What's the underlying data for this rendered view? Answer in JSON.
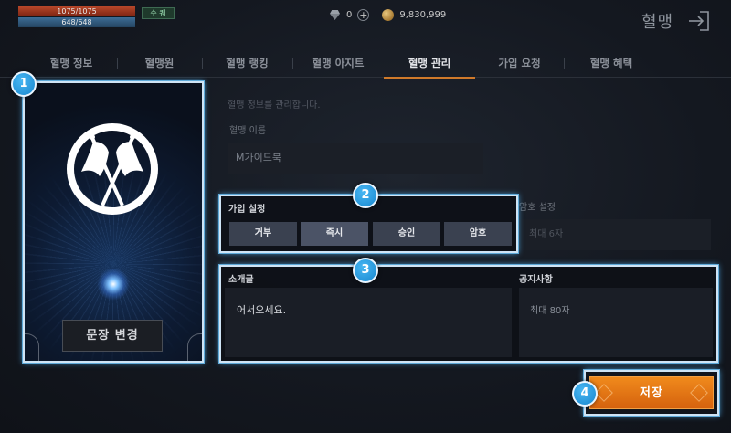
{
  "hud": {
    "hp_text": "1075/1075",
    "mp_text": "648/648",
    "buff_text": "수 퀘"
  },
  "currency": {
    "diamond_amount": "0",
    "gold_amount": "9,830,999"
  },
  "header": {
    "title": "혈맹"
  },
  "tabs": [
    {
      "label": "혈맹 정보"
    },
    {
      "label": "혈맹원"
    },
    {
      "label": "혈맹 랭킹"
    },
    {
      "label": "혈맹 아지트"
    },
    {
      "label": "혈맹 관리",
      "active": true
    },
    {
      "label": "가입 요청"
    },
    {
      "label": "혈맹 혜택"
    }
  ],
  "emblem": {
    "change_button_label": "문장 변경"
  },
  "management": {
    "description": "혈맹 정보를 관리합니다.",
    "clan_name_label": "혈맹 이름",
    "clan_name_value": "M가이드북",
    "join_setting_label": "가입 설정",
    "join_options": [
      {
        "label": "거부"
      },
      {
        "label": "즉시",
        "selected": true
      },
      {
        "label": "승인"
      },
      {
        "label": "암호"
      }
    ],
    "password_label": "암호 설정",
    "password_placeholder": "최대 6자",
    "intro_label": "소개글",
    "intro_text": "어서오세요.",
    "notice_label": "공지사항",
    "notice_placeholder": "최대 80자",
    "save_label": "저장"
  },
  "badges": [
    "1",
    "2",
    "3",
    "4"
  ],
  "colors": {
    "accent": "#d07a2a",
    "highlight_border": "#5ea9d8",
    "save_button": "#e8761a",
    "badge": "#1787cf"
  }
}
